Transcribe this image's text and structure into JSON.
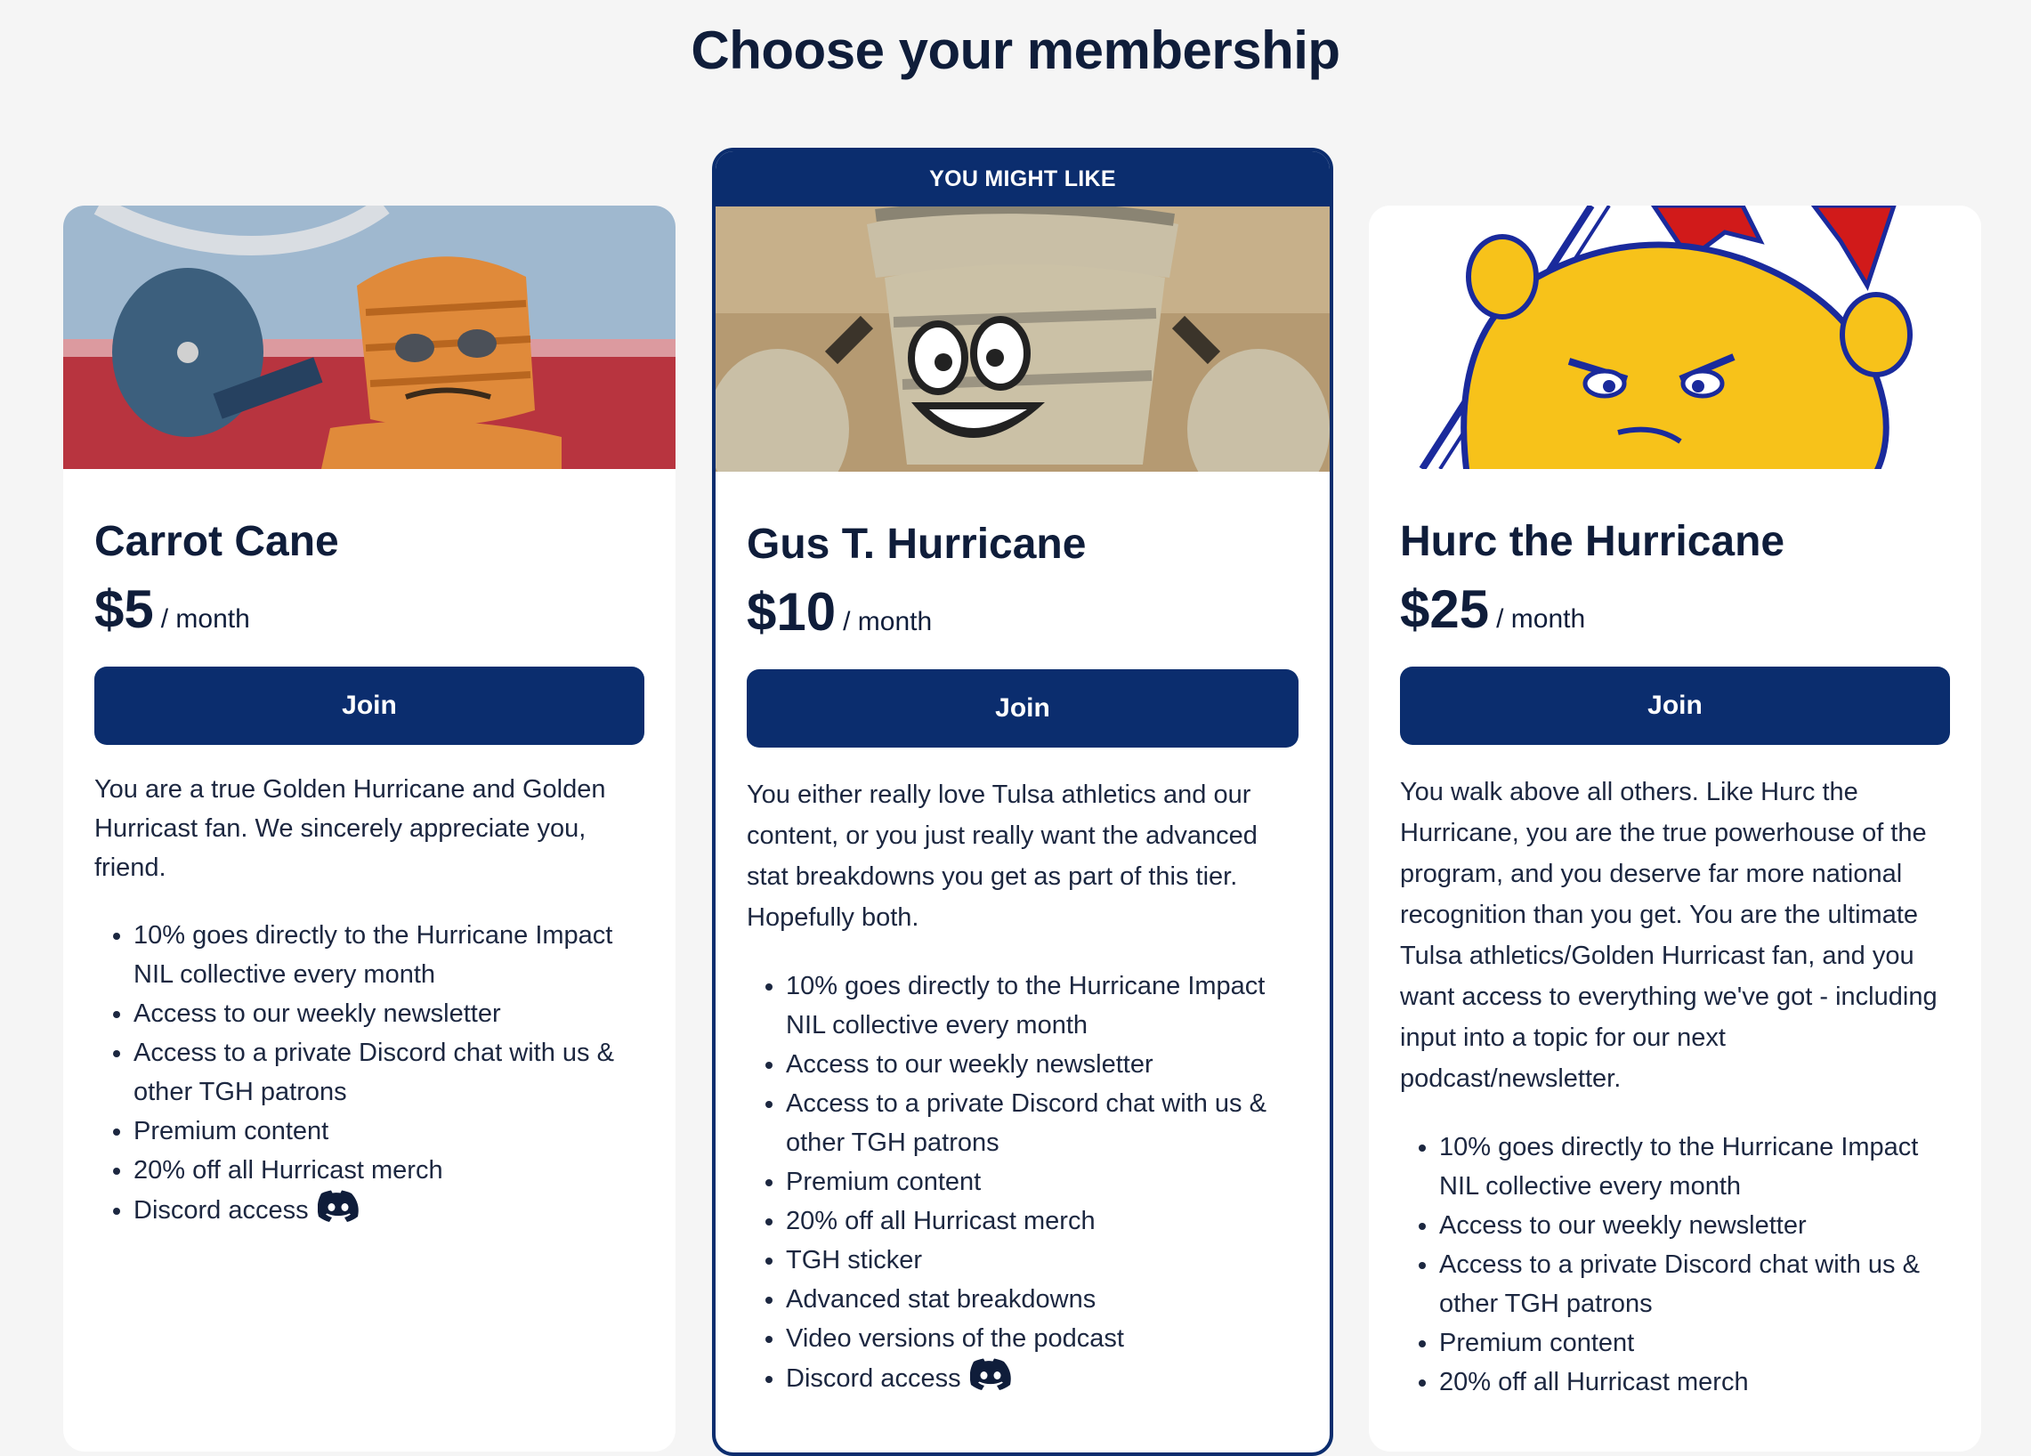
{
  "page": {
    "title": "Choose your membership"
  },
  "tiers": [
    {
      "name": "Carrot Cane",
      "price": "$5",
      "per": "/ month",
      "join_label": "Join",
      "description": "You are a true Golden Hurricane and Golden Hurricast fan. We sincerely appreciate you, friend.",
      "benefits": [
        "10% goes directly to the Hurricane Impact NIL collective every month",
        "Access to our weekly newsletter",
        "Access to a private Discord chat with us & other TGH patrons",
        "Premium content",
        "20% off all Hurricast merch",
        "Discord access"
      ],
      "image_icon": "mascot-photo-icon"
    },
    {
      "badge": "YOU MIGHT LIKE",
      "name": "Gus T. Hurricane",
      "price": "$10",
      "per": "/ month",
      "join_label": "Join",
      "description": "You either really love Tulsa athletics and our content, or you just really want the advanced stat breakdowns you get as part of this tier. Hopefully both.",
      "benefits": [
        "10% goes directly to the Hurricane Impact NIL collective every month",
        "Access to our weekly newsletter",
        "Access to a private Discord chat with us & other TGH patrons",
        "Premium content",
        "20% off all Hurricast merch",
        "TGH sticker",
        "Advanced stat breakdowns",
        "Video versions of the podcast",
        "Discord access"
      ],
      "image_icon": "mascot-photo-icon"
    },
    {
      "name": "Hurc the Hurricane",
      "price": "$25",
      "per": "/ month",
      "join_label": "Join",
      "description": "You walk above all others. Like Hurc the Hurricane, you are the true powerhouse of the program, and you deserve far more national recognition than you get. You are the ultimate Tulsa athletics/Golden Hurricast fan, and you want access to everything we've got - including input into a topic for our next podcast/newsletter.",
      "benefits": [
        "10% goes directly to the Hurricane Impact NIL collective every month",
        "Access to our weekly newsletter",
        "Access to a private Discord chat with us & other TGH patrons",
        "Premium content",
        "20% off all Hurricast merch"
      ],
      "image_icon": "mascot-cartoon-icon"
    }
  ],
  "colors": {
    "brand": "#0b2d6e",
    "text": "#0f1d3a",
    "background": "#f5f5f5"
  }
}
